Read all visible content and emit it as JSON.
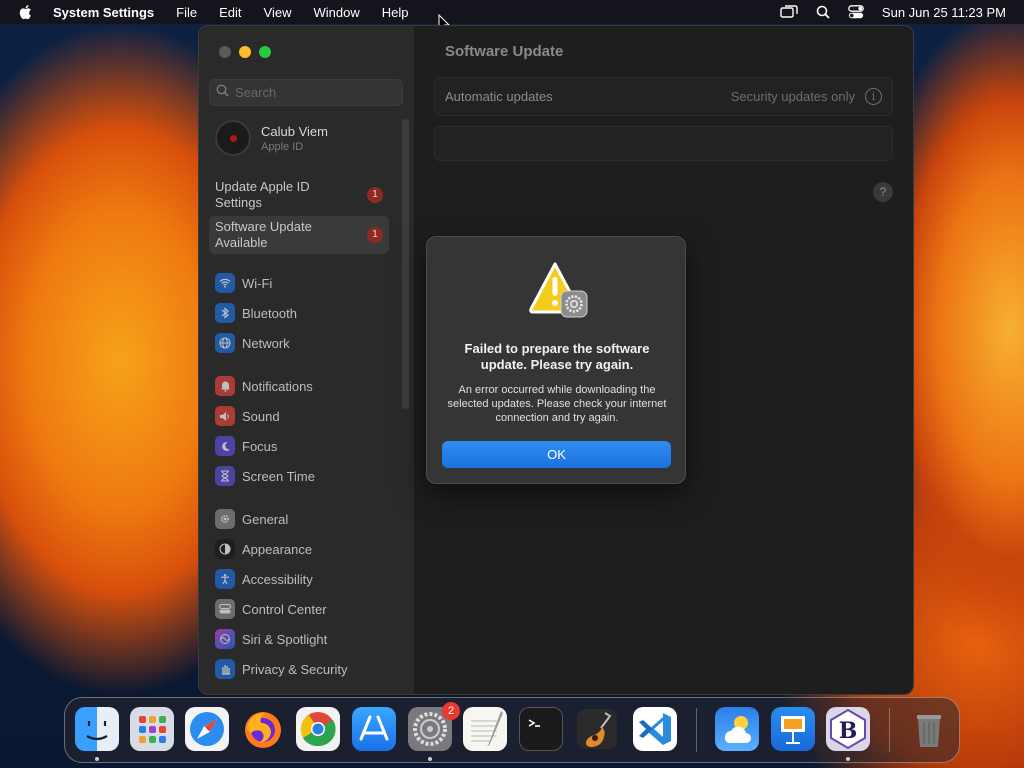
{
  "menubar": {
    "app_name": "System Settings",
    "items": [
      "File",
      "Edit",
      "View",
      "Window",
      "Help"
    ],
    "datetime": "Sun Jun 25  11:23 PM"
  },
  "sidebar": {
    "search_placeholder": "Search",
    "account": {
      "name": "Calub Viem",
      "subtitle": "Apple ID"
    },
    "notices": [
      {
        "label": "Update Apple ID Settings",
        "badge": "1"
      },
      {
        "label": "Software Update Available",
        "badge": "1"
      }
    ],
    "items": [
      {
        "label": "Wi-Fi",
        "icon": "wifi-icon",
        "color": "#1e6fd9"
      },
      {
        "label": "Bluetooth",
        "icon": "bluetooth-icon",
        "color": "#1e6fd9"
      },
      {
        "label": "Network",
        "icon": "globe-icon",
        "color": "#1e6fd9"
      },
      {
        "label": "Notifications",
        "icon": "bell-icon",
        "color": "#e0463a"
      },
      {
        "label": "Sound",
        "icon": "speaker-icon",
        "color": "#e0463a"
      },
      {
        "label": "Focus",
        "icon": "moon-icon",
        "color": "#5a4fd6"
      },
      {
        "label": "Screen Time",
        "icon": "hourglass-icon",
        "color": "#5a4fd6"
      },
      {
        "label": "General",
        "icon": "gear-icon",
        "color": "#8a8a8a"
      },
      {
        "label": "Appearance",
        "icon": "appearance-icon",
        "color": "#1a1a1a"
      },
      {
        "label": "Accessibility",
        "icon": "accessibility-icon",
        "color": "#1e6fd9"
      },
      {
        "label": "Control Center",
        "icon": "control-center-icon",
        "color": "#8a8a8a"
      },
      {
        "label": "Siri & Spotlight",
        "icon": "siri-icon",
        "color": "#c04adf"
      },
      {
        "label": "Privacy & Security",
        "icon": "hand-icon",
        "color": "#1e6fd9"
      }
    ]
  },
  "main": {
    "title": "Software Update",
    "automatic_updates_label": "Automatic updates",
    "automatic_updates_value": "Security updates only",
    "help": "?"
  },
  "alert": {
    "title": "Failed to prepare the software update. Please try again.",
    "message": "An error occurred while downloading the selected updates. Please check your internet connection and try again.",
    "ok_label": "OK"
  },
  "dock": {
    "apps": [
      {
        "name": "Finder",
        "icon": "finder-icon",
        "running": true
      },
      {
        "name": "Launchpad",
        "icon": "launchpad-icon",
        "running": false
      },
      {
        "name": "Safari",
        "icon": "safari-icon",
        "running": false
      },
      {
        "name": "Firefox",
        "icon": "firefox-icon",
        "running": false
      },
      {
        "name": "Chrome",
        "icon": "chrome-icon",
        "running": false
      },
      {
        "name": "App Store",
        "icon": "app-store-icon",
        "running": false
      },
      {
        "name": "System Settings",
        "icon": "system-settings-icon",
        "running": true,
        "badge": "2"
      },
      {
        "name": "TextEdit",
        "icon": "textedit-icon",
        "running": false
      },
      {
        "name": "Terminal",
        "icon": "terminal-icon",
        "running": false
      },
      {
        "name": "GarageBand",
        "icon": "garageband-icon",
        "running": false
      },
      {
        "name": "Visual Studio Code",
        "icon": "vscode-icon",
        "running": false
      },
      {
        "name": "Weather",
        "icon": "weather-icon",
        "running": false
      },
      {
        "name": "Keynote",
        "icon": "keynote-icon",
        "running": false
      },
      {
        "name": "BBEdit",
        "icon": "bbedit-icon",
        "running": true
      },
      {
        "name": "Trash",
        "icon": "trash-icon",
        "running": false
      }
    ]
  }
}
